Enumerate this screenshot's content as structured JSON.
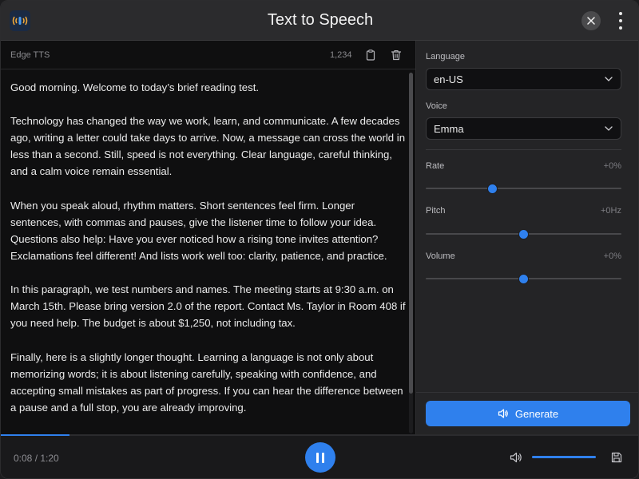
{
  "app": {
    "title": "Text to Speech",
    "icon": "sound-wave-icon",
    "accent_color": "#2f80ed"
  },
  "editor": {
    "engine_label": "Edge TTS",
    "char_count": "1,234",
    "copy_icon": "clipboard-icon",
    "delete_icon": "trash-icon",
    "paragraphs": [
      "Good morning. Welcome to today’s brief reading test.",
      "Technology has changed the way we work, learn, and communicate. A few decades ago, writing a letter could take days to arrive. Now, a message can cross the world in less than a second. Still, speed is not everything. Clear language, careful thinking, and a calm voice remain essential.",
      "When you speak aloud, rhythm matters. Short sentences feel firm. Longer sentences, with commas and pauses, give the listener time to follow your idea. Questions also help: Have you ever noticed how a rising tone invites attention? Exclamations feel different! And lists work well too: clarity, patience, and practice.",
      "In this paragraph, we test numbers and names. The meeting starts at 9:30 a.m. on March 15th. Please bring version 2.0 of the report. Contact Ms. Taylor in Room 408  if you need help. The budget is about $1,250, not including tax.",
      "Finally, here is a slightly longer thought. Learning a language is not only about memorizing words; it is about listening carefully, speaking with confidence, and accepting small mistakes as part of progress. If you can hear the difference between a pause and a full stop, you are already improving."
    ]
  },
  "settings": {
    "language": {
      "label": "Language",
      "value": "en-US"
    },
    "voice": {
      "label": "Voice",
      "value": "Emma"
    },
    "rate": {
      "label": "Rate",
      "value": "+0%",
      "level": 0.34
    },
    "pitch": {
      "label": "Pitch",
      "value": "+0Hz",
      "level": 0.5
    },
    "volume": {
      "label": "Volume",
      "value": "+0%",
      "level": 0.5
    },
    "generate_label": "Generate",
    "generate_icon": "speaker-icon"
  },
  "player": {
    "time_current": "0:08",
    "time_total": "1:20",
    "progress": 0.107,
    "volume_level": 1.0,
    "pause_icon": "pause-icon",
    "volume_icon": "volume-icon",
    "save_icon": "save-icon"
  }
}
